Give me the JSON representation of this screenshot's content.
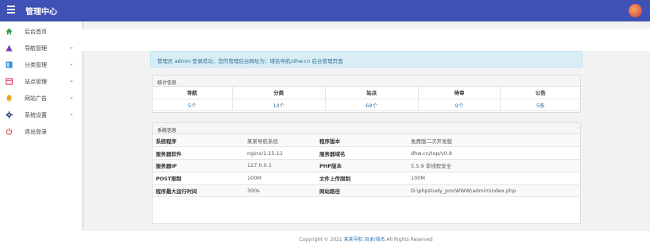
{
  "header": {
    "title": "管理中心"
  },
  "sidebar": {
    "items": [
      {
        "label": "后台首页",
        "icon": "home-icon",
        "color": "#2e9d4f",
        "has_sub": false
      },
      {
        "label": "导航管理",
        "icon": "triangle-icon",
        "color": "#7b3fb6",
        "has_sub": true
      },
      {
        "label": "分类管理",
        "icon": "folder-icon",
        "color": "#2f8fd8",
        "has_sub": true
      },
      {
        "label": "站点管理",
        "icon": "site-icon",
        "color": "#e84a6a",
        "has_sub": true
      },
      {
        "label": "网站广告",
        "icon": "bell-icon",
        "color": "#f2a21c",
        "has_sub": true
      },
      {
        "label": "系统设置",
        "icon": "gear-icon",
        "color": "#2d4a7a",
        "has_sub": true
      },
      {
        "label": "退出登录",
        "icon": "power-icon",
        "color": "#e64c3c",
        "has_sub": false
      }
    ]
  },
  "alert": {
    "text": "管理员 admin 登录成功，您的管理后台网址为：域名导航/dhw.cn 后台管理页面"
  },
  "stats": {
    "title": "统计信息",
    "columns": [
      "导航",
      "分类",
      "站点",
      "待审",
      "公告"
    ],
    "values": [
      "5个",
      "14个",
      "68个",
      "9个",
      "5条"
    ]
  },
  "sysinfo": {
    "title": "系统信息",
    "rows": [
      [
        "系统程序",
        "某某导航系统",
        "程序版本",
        "免费版二次开发版"
      ],
      [
        "服务器软件",
        "nginx/1.15.11",
        "服务器域名",
        "dhw.cn/top/v0.9"
      ],
      [
        "服务器IP",
        "127.0.0.1",
        "PHP版本",
        "5.5.9 非线程安全"
      ],
      [
        "POST限制",
        "100M",
        "文件上传限制",
        "100M"
      ],
      [
        "程序最大运行时间",
        "300s",
        "网站路径",
        "D:\\phpstudy_pro\\WWW\\admin\\index.php"
      ]
    ]
  },
  "footer": {
    "prefix": "Copyright © 2021",
    "link": "某某导航 目录/域名",
    "suffix": "All Rights Reserved"
  }
}
